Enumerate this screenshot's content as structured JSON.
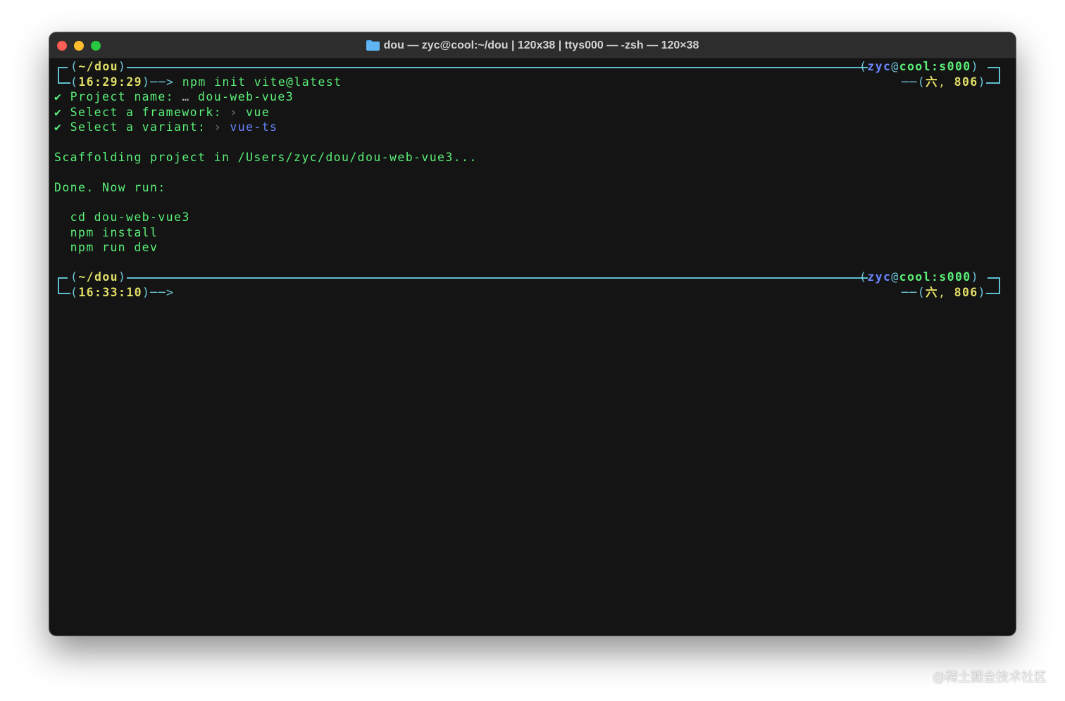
{
  "window": {
    "title": "dou — zyc@cool:~/dou | 120x38 | ttys000 — -zsh — 120×38",
    "title_icon": "folder-icon"
  },
  "prompt1": {
    "dir": "~/dou",
    "time": "16:29:29",
    "arrow": "──>",
    "command": " npm init vite@latest",
    "user": "zyc",
    "host": "cool:s000",
    "day": "六",
    "sep": ",",
    "num": "806"
  },
  "output": {
    "check": "✔",
    "project_label": " Project name: ",
    "project_ellipsis": "…",
    "project_value": " dou-web-vue3",
    "framework_label": " Select a framework: ",
    "framework_chevron": "›",
    "framework_value": " vue",
    "variant_label": " Select a variant: ",
    "variant_chevron": "›",
    "variant_value": " vue-ts",
    "scaffolding": "Scaffolding project in /Users/zyc/dou/dou-web-vue3...",
    "done": "Done. Now run:",
    "cmd1": "  cd dou-web-vue3",
    "cmd2": "  npm install",
    "cmd3": "  npm run dev"
  },
  "prompt2": {
    "dir": "~/dou",
    "time": "16:33:10",
    "arrow": "──>",
    "user": "zyc",
    "host": "cool:s000",
    "day": "六",
    "sep": ",",
    "num": "806"
  },
  "watermark": "@稀土掘金技术社区",
  "colors": {
    "terminal_bg": "#141414",
    "titlebar_bg": "#2d2d2d",
    "green": "#5af078",
    "yellow": "#e2df67",
    "cyan": "#6fc6d8",
    "blue": "#6a86ff"
  }
}
